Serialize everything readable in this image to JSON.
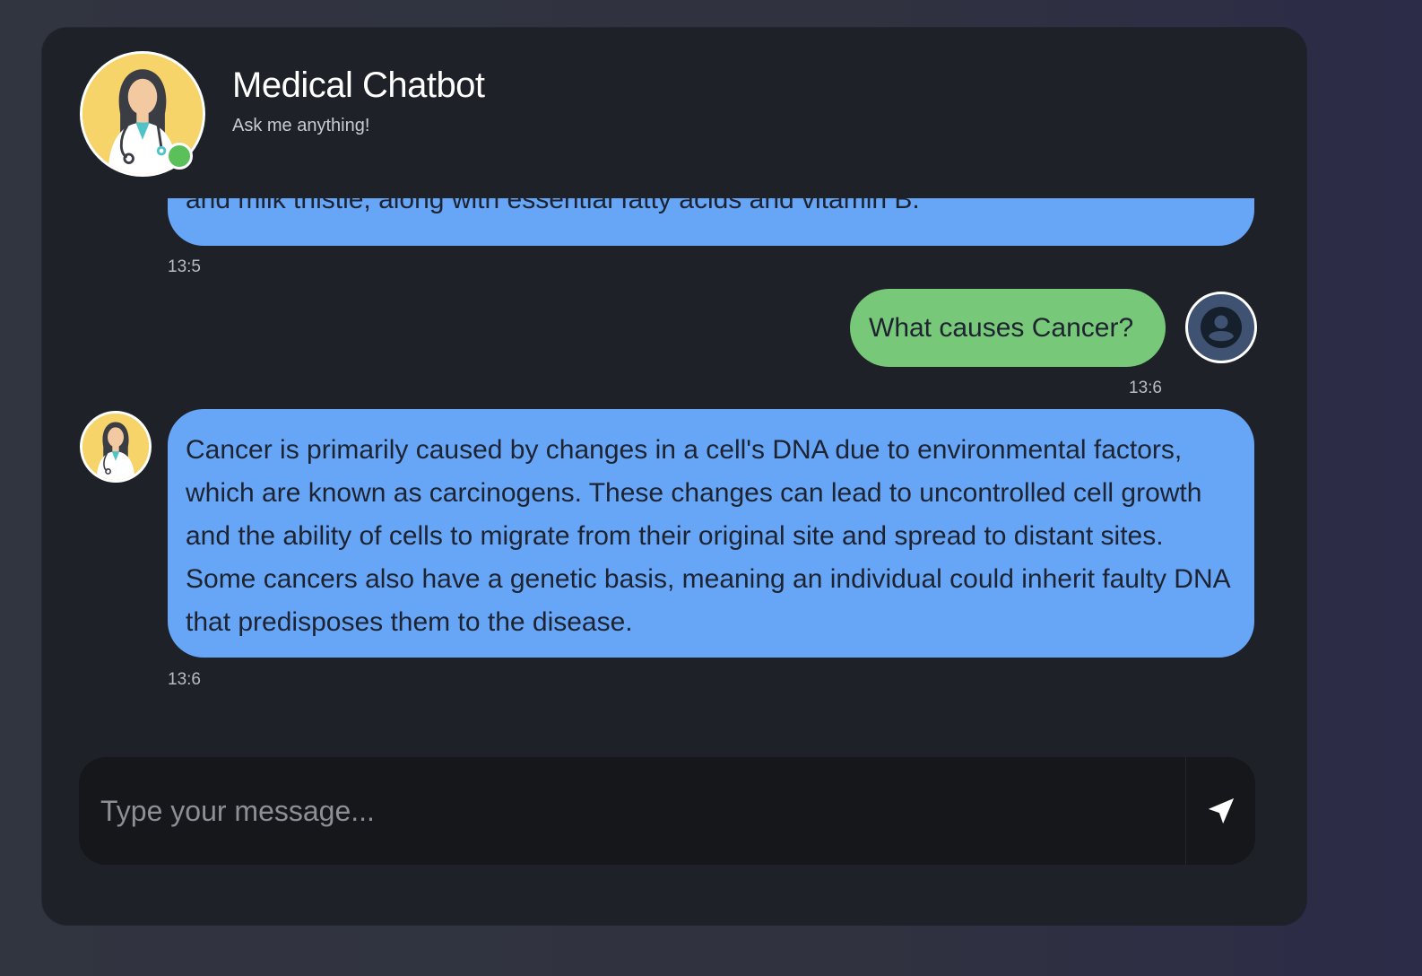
{
  "header": {
    "title": "Medical Chatbot",
    "subtitle": "Ask me anything!",
    "status_color": "#5ac05a"
  },
  "messages": [
    {
      "sender": "bot",
      "text": "and milk thistle, along with essential fatty acids and vitamin B.",
      "time": "13:5"
    },
    {
      "sender": "user",
      "text": "What causes Cancer?",
      "time": "13:6"
    },
    {
      "sender": "bot",
      "text": "Cancer is primarily caused by changes in a cell's DNA due to environmental factors, which are known as carcinogens. These changes can lead to uncontrolled cell growth and the ability of cells to migrate from their original site and spread to distant sites. Some cancers also have a genetic basis, meaning an individual could inherit faulty DNA that predisposes them to the disease.",
      "time": "13:6"
    }
  ],
  "composer": {
    "placeholder": "Type your message...",
    "value": "",
    "send_icon": "send-icon"
  },
  "colors": {
    "bot_bubble": "#67a6f6",
    "user_bubble": "#78c879",
    "card_bg": "#1f2128"
  }
}
